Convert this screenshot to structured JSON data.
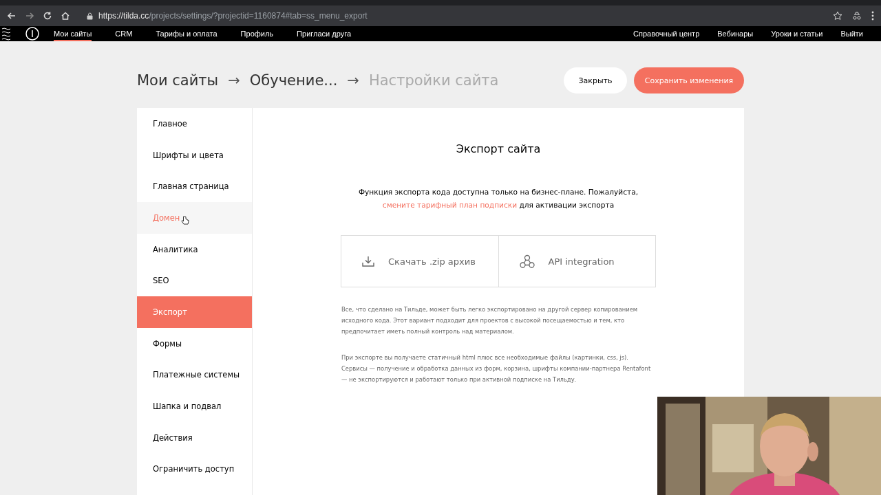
{
  "browser": {
    "url_host": "https://tilda.cc",
    "url_path": "/projects/settings/?projectid=1160874#tab=ss_menu_export"
  },
  "top_nav": {
    "left": [
      {
        "label": "Мои сайты",
        "selected": true
      },
      {
        "label": "CRM",
        "selected": false
      },
      {
        "label": "Тарифы и оплата",
        "selected": false
      },
      {
        "label": "Профиль",
        "selected": false
      },
      {
        "label": "Пригласи друга",
        "selected": false
      }
    ],
    "right": [
      "Справочный центр",
      "Вебинары",
      "Уроки и статьи",
      "Выйти"
    ]
  },
  "breadcrumb": [
    {
      "label": "Мои сайты",
      "current": false
    },
    {
      "label": "Обучение...",
      "current": false
    },
    {
      "label": "Настройки сайта",
      "current": true
    }
  ],
  "breadcrumb_separator": "→",
  "buttons": {
    "close": "Закрыть",
    "save": "Сохранить изменения"
  },
  "sidebar": {
    "items": [
      {
        "label": "Главное",
        "selected": false,
        "hovered": false
      },
      {
        "label": "Шрифты и цвета",
        "selected": false,
        "hovered": false
      },
      {
        "label": "Главная страница",
        "selected": false,
        "hovered": false
      },
      {
        "label": "Домен",
        "selected": false,
        "hovered": true
      },
      {
        "label": "Аналитика",
        "selected": false,
        "hovered": false
      },
      {
        "label": "SEO",
        "selected": false,
        "hovered": false
      },
      {
        "label": "Экспорт",
        "selected": true,
        "hovered": false
      },
      {
        "label": "Формы",
        "selected": false,
        "hovered": false
      },
      {
        "label": "Платежные системы",
        "selected": false,
        "hovered": false
      },
      {
        "label": "Шапка и подвал",
        "selected": false,
        "hovered": false
      },
      {
        "label": "Действия",
        "selected": false,
        "hovered": false
      },
      {
        "label": "Ограничить доступ",
        "selected": false,
        "hovered": false
      }
    ]
  },
  "content": {
    "title": "Экспорт сайта",
    "notice": {
      "before": "Функция экспорта кода доступна только на бизнес-плане. Пожалуйста, ",
      "link": "смените тарифный план подписки",
      "after": " для активации экспорта"
    },
    "options": [
      {
        "kind": "download",
        "label": "Скачать .zip архив"
      },
      {
        "kind": "api",
        "label": "API integration"
      }
    ],
    "paragraphs": [
      "Все, что сделано на Тильде, может быть легко экспортировано на другой сервер копированием исходного кода. Этот вариант подходит для проектов с высокой посещаемостью и тем, кто предпочитает иметь полный контроль над материалом.",
      "При экспорте вы получаете статичный html плюс все необходимые файлы (картинки, css, js). Сервисы — получение и обработка данных из форм, корзина, шрифты компании-партнера Rentafont — не экспортируются и работают только при активной подписке на Тильду."
    ]
  }
}
